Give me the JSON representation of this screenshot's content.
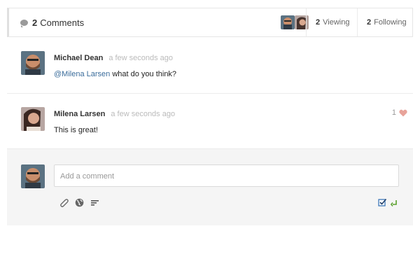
{
  "header": {
    "comment_count": "2",
    "comment_label": "Comments",
    "viewing_count": "2",
    "viewing_label": "Viewing",
    "following_count": "2",
    "following_label": "Following"
  },
  "comments": [
    {
      "author": "Michael Dean",
      "time": "a few seconds ago",
      "mention": "@Milena Larsen",
      "text": " what do you think?"
    },
    {
      "author": "Milena Larsen",
      "time": "a few seconds ago",
      "text": "This is great!",
      "likes": "1"
    }
  ],
  "compose": {
    "placeholder": "Add a comment"
  },
  "colors": {
    "mention": "#3a6c9b",
    "heart": "#e8a39a",
    "checkbox": "#2f6db5",
    "enter": "#5aa02c"
  }
}
